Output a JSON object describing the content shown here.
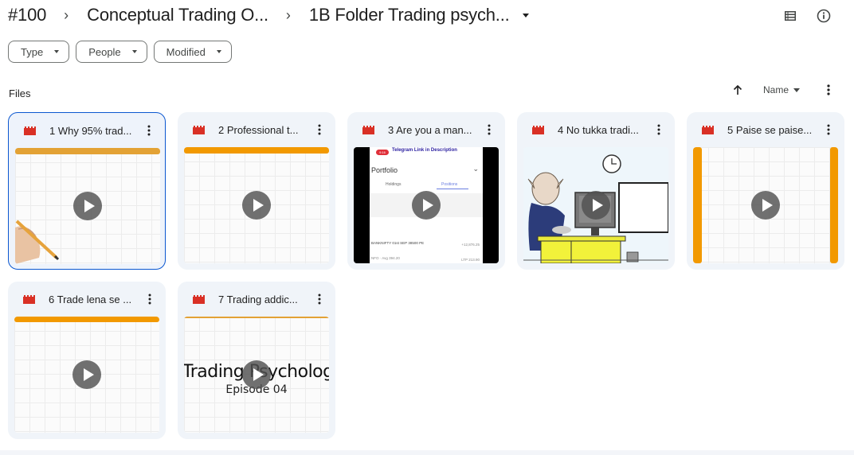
{
  "breadcrumb": {
    "items": [
      "#100",
      "Conceptual Trading  O...",
      "1B Folder Trading psych..."
    ],
    "separator": "›"
  },
  "header_icons": [
    "list-view-icon",
    "info-icon"
  ],
  "filters": [
    {
      "label": "Type"
    },
    {
      "label": "People"
    },
    {
      "label": "Modified"
    }
  ],
  "files_section": {
    "label": "Files",
    "sort_field": "Name",
    "sort_direction": "ascending"
  },
  "files": [
    {
      "title": "1 Why 95% trad...",
      "type": "video",
      "selected": true,
      "thumbnail": "whiteboard-grid-with-hand"
    },
    {
      "title": "2 Professional t...",
      "type": "video",
      "selected": false,
      "thumbnail": "whiteboard-grid"
    },
    {
      "title": "3 Are you a man...",
      "type": "video",
      "selected": false,
      "thumbnail": "phone-portfolio-screen",
      "thumb_text": {
        "banner": "Telegram Link in Description",
        "heading": "Portfolio",
        "tab1": "Holdings",
        "tab2": "Positions",
        "row1": "BANKNIFTY 01st SEP 38500 PE",
        "row1_val": "+12,876.25",
        "row2": "NFO · Avg 394.20",
        "row2_val": "LTP 213.90",
        "badge": "9:16"
      }
    },
    {
      "title": "4 No tukka tradi...",
      "type": "video",
      "selected": false,
      "thumbnail": "cartoon-man-at-computer"
    },
    {
      "title": "5 Paise se paise...",
      "type": "video",
      "selected": false,
      "thumbnail": "whiteboard-grid-orange-sides"
    },
    {
      "title": "6 Trade lena se ...",
      "type": "video",
      "selected": false,
      "thumbnail": "whiteboard-grid"
    },
    {
      "title": "7 Trading addic...",
      "type": "video",
      "selected": false,
      "thumbnail": "title-card",
      "thumb_text": {
        "line1": "Trading Psychology",
        "line2": "Episode 04"
      }
    }
  ],
  "colors": {
    "accent": "#0b57d0",
    "video_icon": "#d93025",
    "card_bg": "#f0f4f9",
    "orange": "#f29900"
  }
}
